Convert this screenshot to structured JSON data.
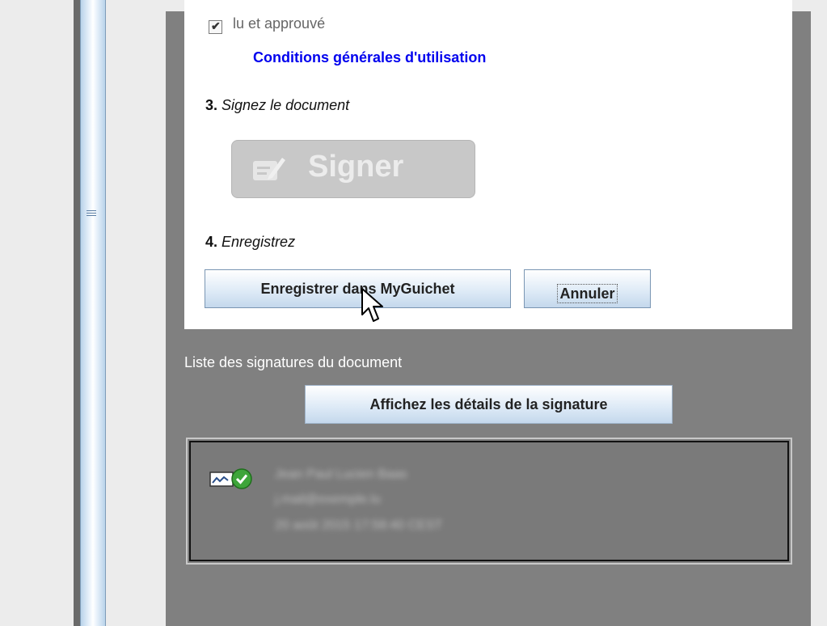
{
  "form": {
    "approve_label": "lu et approuvé",
    "approve_checked": true,
    "terms_link": "Conditions générales d'utilisation",
    "step3": {
      "number": "3.",
      "title": "Signez le document"
    },
    "sign_button": {
      "label": "Signer",
      "enabled": false
    },
    "step4": {
      "number": "4.",
      "title": "Enregistrez"
    },
    "save_button": "Enregistrer dans MyGuichet",
    "cancel_button": "Annuler"
  },
  "signatures": {
    "title": "Liste des signatures du document",
    "details_button": "Affichez les détails de la signature",
    "items": [
      {
        "status_icon": "signature-valid-icon",
        "name": "Jean Paul Lucien Baas",
        "email": "j.mail@exemple.lu",
        "date": "20 août 2015 17:58:40 CEST"
      }
    ]
  },
  "colors": {
    "link": "#0000ee",
    "panel_bg": "#808080",
    "button_gradient_end": "#c4d8ec"
  }
}
